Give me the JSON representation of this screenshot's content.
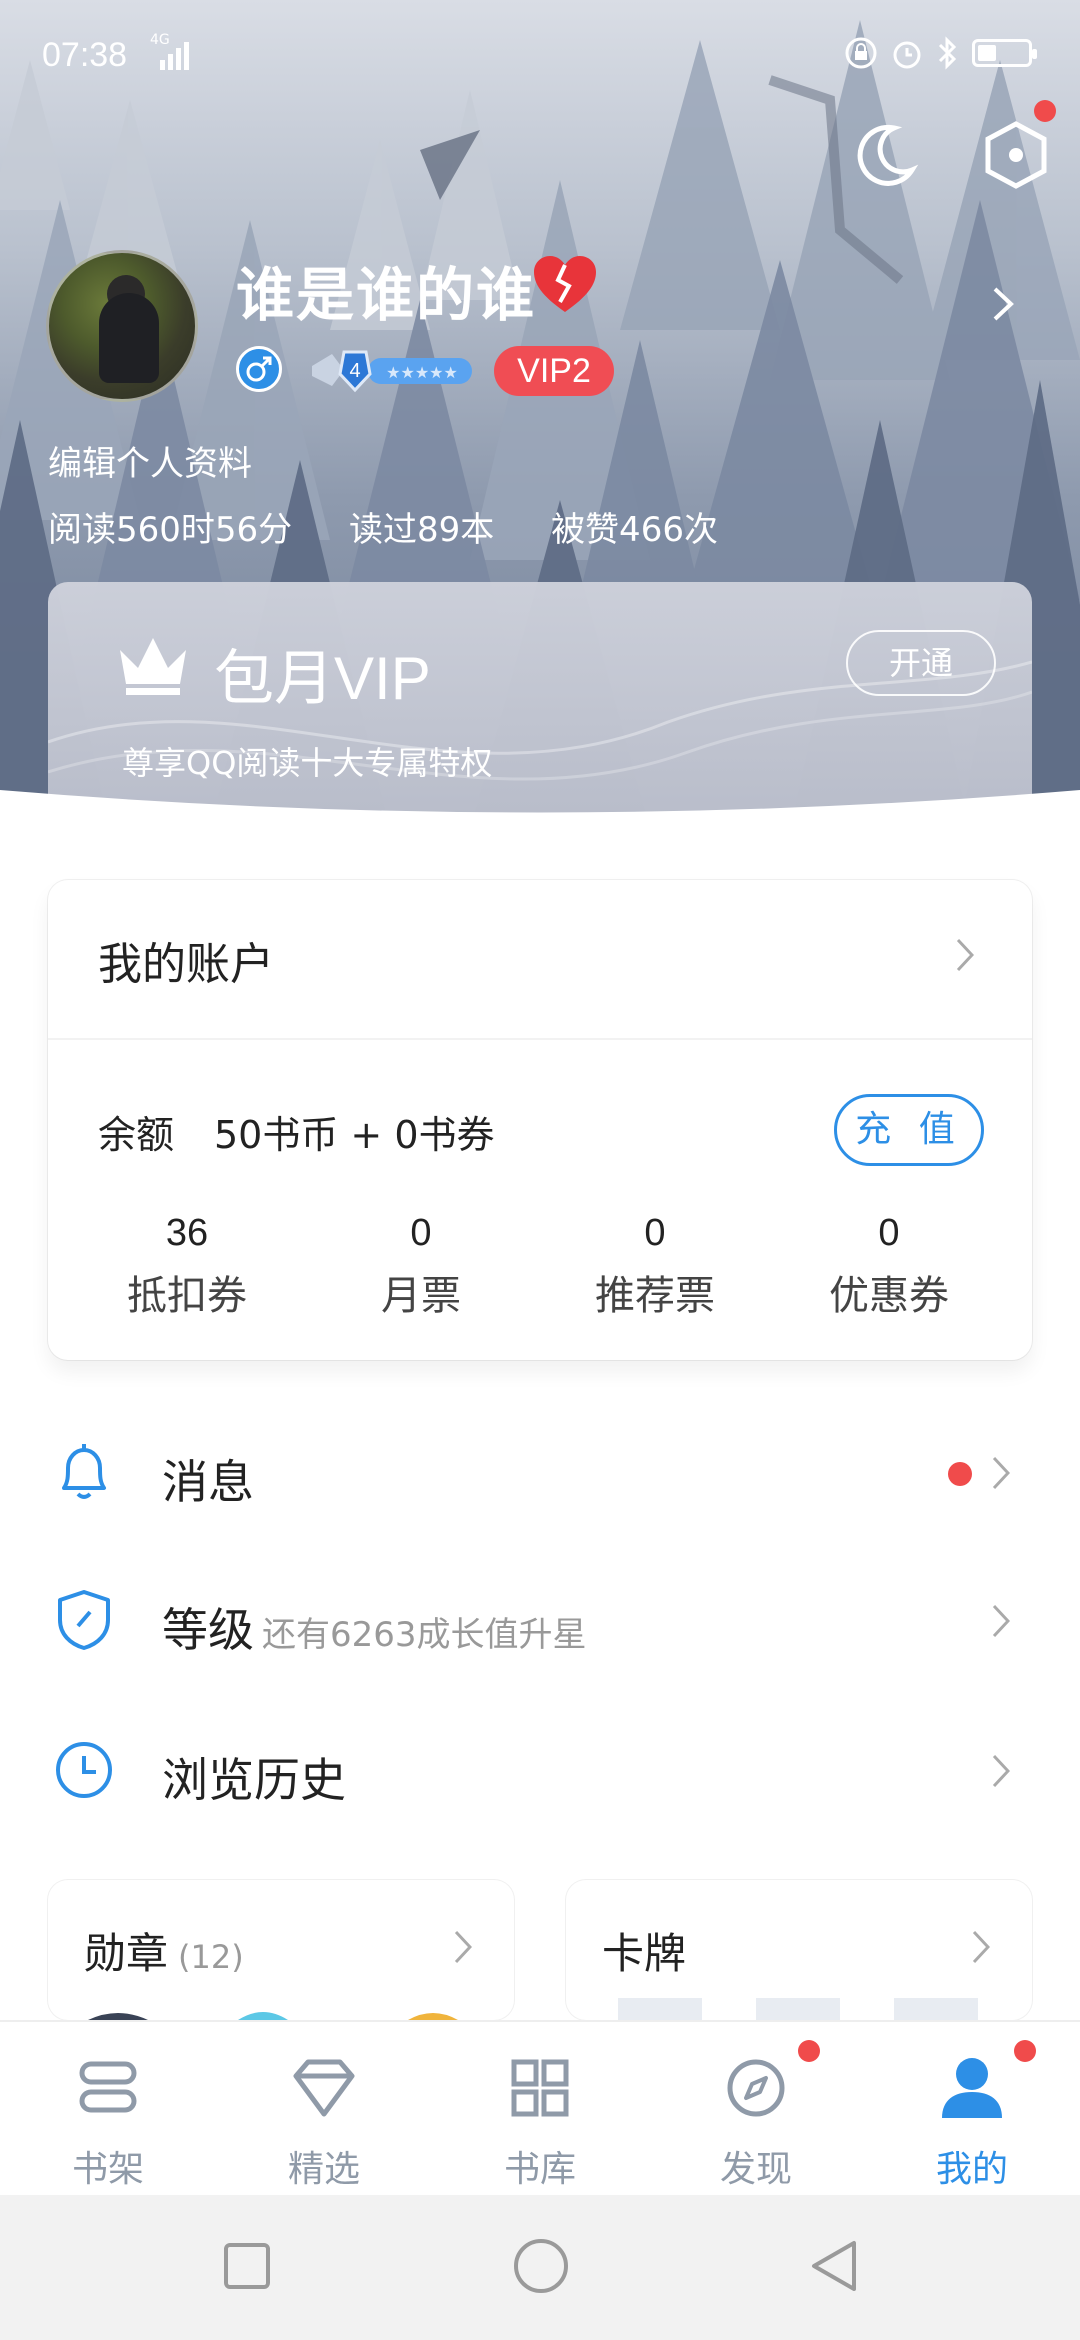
{
  "status_bar": {
    "time": "07:38",
    "network": "4G"
  },
  "profile": {
    "username": "谁是谁的谁",
    "level": "4",
    "vip_level": "VIP2",
    "edit_label": "编辑个人资料",
    "stats": {
      "reading_time": "阅读560时56分",
      "books_read": "读过89本",
      "likes": "被赞466次"
    }
  },
  "vip_card": {
    "title": "包月VIP",
    "subtitle": "尊享QQ阅读十大专属特权",
    "button": "开通"
  },
  "account": {
    "title": "我的账户",
    "balance_label": "余额",
    "balance_value": "50书币 + 0书券",
    "recharge_button": "充 值",
    "stats": [
      {
        "value": "36",
        "label": "抵扣券"
      },
      {
        "value": "0",
        "label": "月票"
      },
      {
        "value": "0",
        "label": "推荐票"
      },
      {
        "value": "0",
        "label": "优惠券"
      }
    ]
  },
  "menu": {
    "messages": {
      "label": "消息",
      "icon": "bell-icon"
    },
    "level": {
      "label": "等级",
      "hint": "还有6263成长值升星",
      "icon": "shield-icon"
    },
    "history": {
      "label": "浏览历史",
      "icon": "clock-icon"
    }
  },
  "cards": {
    "medals": {
      "title": "勋章",
      "count": "(12)"
    },
    "cards": {
      "title": "卡牌"
    }
  },
  "tabs": [
    {
      "label": "书架",
      "icon": "bookshelf-icon"
    },
    {
      "label": "精选",
      "icon": "diamond-icon"
    },
    {
      "label": "书库",
      "icon": "grid-icon"
    },
    {
      "label": "发现",
      "icon": "compass-icon"
    },
    {
      "label": "我的",
      "icon": "person-icon"
    }
  ],
  "colors": {
    "accent": "#2d8fe6",
    "badge_red": "#f04b4b",
    "tab_inactive": "#8f9aa8"
  }
}
